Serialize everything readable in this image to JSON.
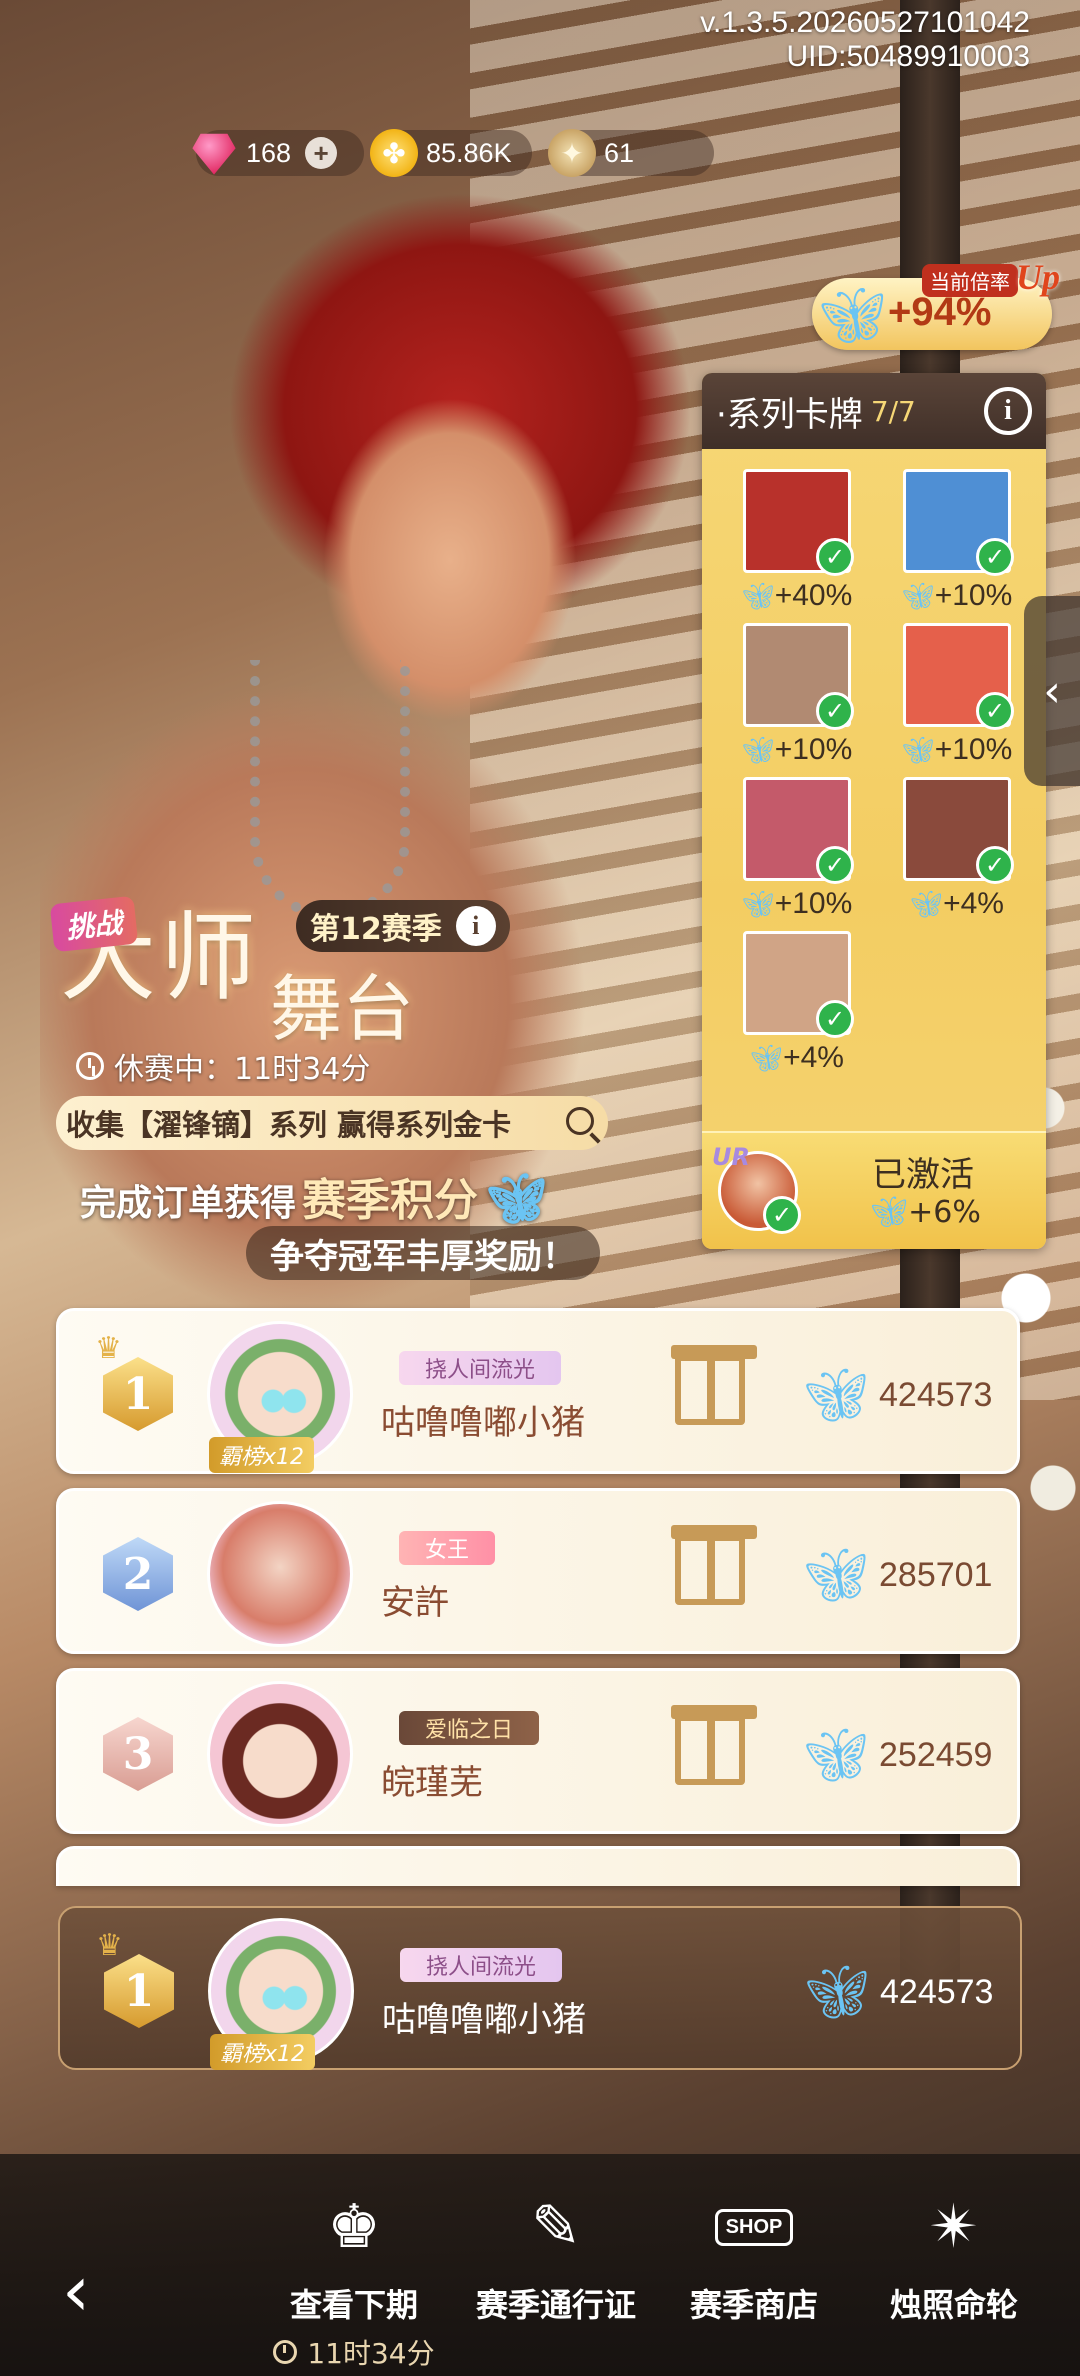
{
  "header": {
    "version": "v.1.3.5.20260527101042",
    "uid": "UID:50489910003"
  },
  "currency": {
    "gems": "168",
    "clover": "85.86K",
    "stars": "61"
  },
  "multiplier": {
    "label": "当前倍率",
    "up": "Up",
    "value": "+94%"
  },
  "series_cards": {
    "title": "·系列卡牌",
    "count": "7/7",
    "info": "i",
    "cards": [
      {
        "bonus": "+40%",
        "color": "#b8312b"
      },
      {
        "bonus": "+10%",
        "color": "#4f8fd4"
      },
      {
        "bonus": "+10%",
        "color": "#b18a72"
      },
      {
        "bonus": "+10%",
        "color": "#e5604b"
      },
      {
        "bonus": "+10%",
        "color": "#c45a6a"
      },
      {
        "bonus": "+4%",
        "color": "#8a4a3c"
      },
      {
        "bonus": "+4%",
        "color": "#d0a486"
      }
    ],
    "activated_label": "已激活",
    "activated_tag": "UR",
    "activated_bonus": "+6%"
  },
  "challenge": {
    "tag": "挑战",
    "title_main": "大师",
    "title_sub": "舞台",
    "season": "第12赛季",
    "info": "i",
    "status": "休赛中：11时34分",
    "collect_text": "收集【濯锋镝】系列 赢得系列金卡",
    "order_prefix": "完成订单获得",
    "order_highlight": "赛季积分",
    "reward_text": "争夺冠军丰厚奖励！"
  },
  "ranking": [
    {
      "rank": "1",
      "name": "咕噜噜嘟小猪",
      "tag": "挠人间流光",
      "bang": "霸榜x12",
      "score": "424573"
    },
    {
      "rank": "2",
      "name": "安許",
      "tag": "女王",
      "bang": "",
      "score": "285701"
    },
    {
      "rank": "3",
      "name": "皖瑾芜",
      "tag": "爱临之日",
      "bang": "",
      "score": "252459"
    }
  ],
  "my_rank": {
    "rank": "1",
    "name": "咕噜噜嘟小猪",
    "tag": "挠人间流光",
    "bang": "霸榜x12",
    "score": "424573"
  },
  "bottom_nav": {
    "back_icon": "‹",
    "items": [
      {
        "label": "查看下期",
        "sub": "11时34分"
      },
      {
        "label": "赛季通行证"
      },
      {
        "label": "赛季商店",
        "shop_sign": "SHOP"
      },
      {
        "label": "烛照命轮"
      }
    ]
  }
}
